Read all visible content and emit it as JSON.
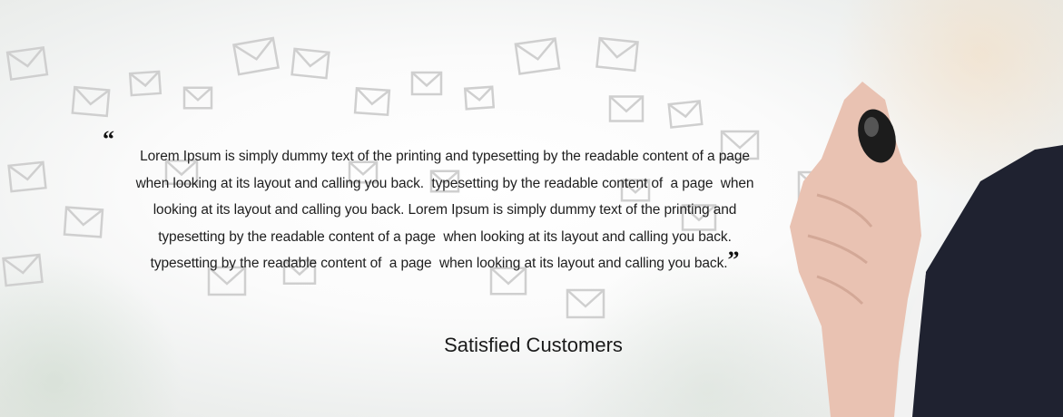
{
  "testimonial": {
    "open_quote": "“",
    "close_quote": "”",
    "lines": [
      "Lorem Ipsum is simply dummy text of the printing and typesetting by the readable content of a page",
      "when looking at its layout and calling you back.  typesetting by the readable content of  a page  when",
      "looking at its layout and calling you back. Lorem Ipsum is simply dummy text of the printing and",
      "typesetting by the readable content of a page  when looking at its layout and calling you back.",
      "typesetting by the readable content of  a page  when looking at its layout and calling you back."
    ],
    "author": "Satisfied Customers"
  },
  "background": {
    "icon": "envelope-icon",
    "envelope_color": "#cfcfcf",
    "suit_color": "#1f2230",
    "skin_color": "#e9c2b2",
    "marker_color": "#1c1c1c"
  }
}
